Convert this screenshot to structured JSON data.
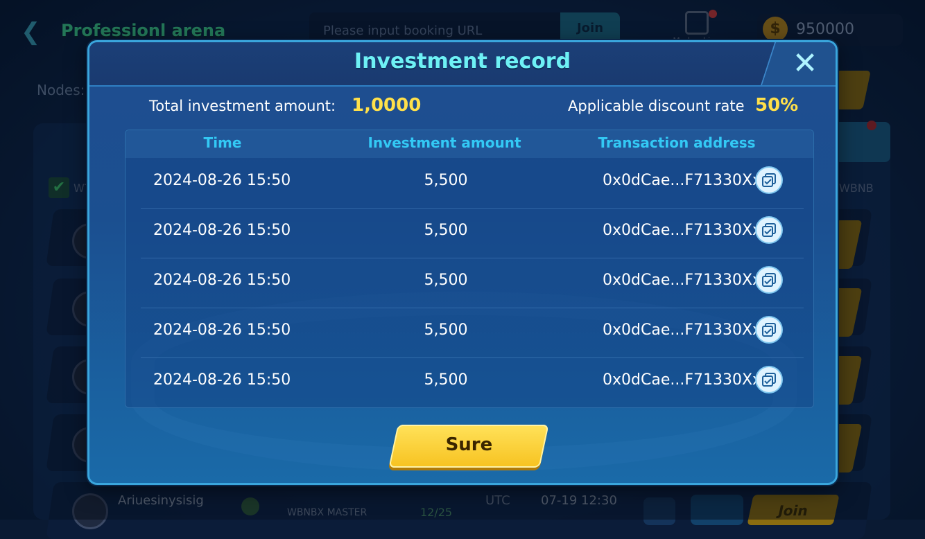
{
  "background": {
    "topbar": {
      "title": "Professionl arena",
      "url_placeholder": "Please input booking URL",
      "join_label": "Join",
      "bookings_label": "My bookings",
      "coins": "950000"
    },
    "nodes_label": "Nodes:",
    "filter_label": "WT",
    "token_label": "WBNB",
    "bottom_row": {
      "name": "Ariuesinysisig",
      "team": "WBNBX MASTER",
      "count": "12/25",
      "utc_label": "UTC",
      "date": "07-19  12:30",
      "join_label": "Join"
    }
  },
  "modal": {
    "title": "Investment record",
    "total_label": "Total investment amount:",
    "total_value": "1,0000",
    "discount_label": "Applicable discount rate",
    "discount_value": "50%",
    "columns": {
      "time": "Time",
      "amount": "Investment amount",
      "address": "Transaction address"
    },
    "rows": [
      {
        "time": "2024-08-26  15:50",
        "amount": "5,500",
        "address": "0x0dCae...F71330Xx"
      },
      {
        "time": "2024-08-26  15:50",
        "amount": "5,500",
        "address": "0x0dCae...F71330Xx"
      },
      {
        "time": "2024-08-26  15:50",
        "amount": "5,500",
        "address": "0x0dCae...F71330Xx"
      },
      {
        "time": "2024-08-26  15:50",
        "amount": "5,500",
        "address": "0x0dCae...F71330Xx"
      },
      {
        "time": "2024-08-26  15:50",
        "amount": "5,500",
        "address": "0x0dCae...F71330Xx"
      }
    ],
    "confirm_label": "Sure",
    "colors": {
      "title": "#6ef1f5",
      "highlight": "#ffe04a",
      "column_header": "#33c9f5",
      "button": "#f7c220"
    }
  },
  "icons": {
    "back": "back-arrow-icon",
    "bookings": "calendar-clock-icon",
    "coin": "dollar-coin-icon",
    "close": "close-icon",
    "copy": "copy-icon",
    "check": "checkmark-icon"
  }
}
